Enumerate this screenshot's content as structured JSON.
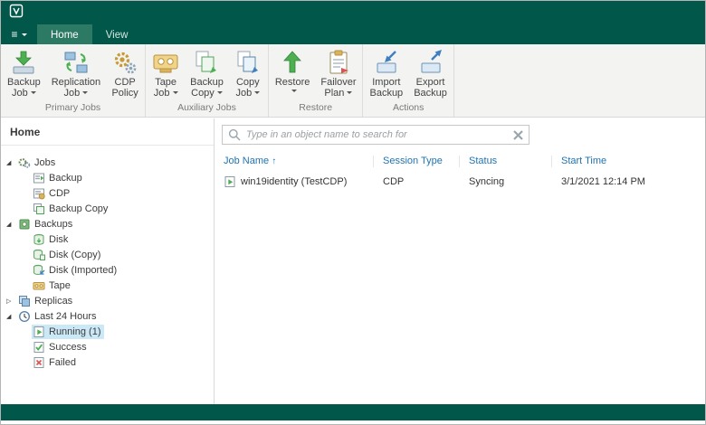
{
  "colors": {
    "brand_green": "#01584a",
    "active_tab_green": "#2c7a63",
    "selection_blue": "#cbe8f7",
    "header_text_blue": "#1d74b4"
  },
  "tabs": [
    {
      "label": "Home"
    },
    {
      "label": "View"
    }
  ],
  "ribbon": {
    "groups": [
      {
        "label": "Primary Jobs",
        "buttons": [
          {
            "line1": "Backup",
            "line2": "Job",
            "dropdown": true
          },
          {
            "line1": "Replication",
            "line2": "Job",
            "dropdown": true
          },
          {
            "line1": "CDP",
            "line2": "Policy",
            "dropdown": false
          }
        ]
      },
      {
        "label": "Auxiliary Jobs",
        "buttons": [
          {
            "line1": "Tape",
            "line2": "Job",
            "dropdown": true
          },
          {
            "line1": "Backup",
            "line2": "Copy",
            "dropdown": true
          },
          {
            "line1": "Copy",
            "line2": "Job",
            "dropdown": true
          }
        ]
      },
      {
        "label": "Restore",
        "buttons": [
          {
            "line1": "Restore",
            "line2": "",
            "dropdown": true
          },
          {
            "line1": "Failover",
            "line2": "Plan",
            "dropdown": true
          }
        ]
      },
      {
        "label": "Actions",
        "buttons": [
          {
            "line1": "Import",
            "line2": "Backup",
            "dropdown": false
          },
          {
            "line1": "Export",
            "line2": "Backup",
            "dropdown": false
          }
        ]
      }
    ]
  },
  "sidebar": {
    "header": "Home",
    "tree": [
      {
        "label": "Jobs"
      },
      {
        "label": "Backup"
      },
      {
        "label": "CDP"
      },
      {
        "label": "Backup Copy"
      },
      {
        "label": "Backups"
      },
      {
        "label": "Disk"
      },
      {
        "label": "Disk (Copy)"
      },
      {
        "label": "Disk (Imported)"
      },
      {
        "label": "Tape"
      },
      {
        "label": "Replicas"
      },
      {
        "label": "Last 24 Hours"
      },
      {
        "label": "Running (1)"
      },
      {
        "label": "Success"
      },
      {
        "label": "Failed"
      }
    ]
  },
  "main": {
    "search": {
      "placeholder": "Type in an object name to search for"
    },
    "table": {
      "headers": {
        "job_name": "Job Name",
        "session_type": "Session Type",
        "status": "Status",
        "start_time": "Start Time"
      },
      "sort_indicator": "↑",
      "rows": [
        {
          "job_name": "win19identity (TestCDP)",
          "session_type": "CDP",
          "status": "Syncing",
          "start_time": "3/1/2021 12:14 PM"
        }
      ]
    }
  }
}
